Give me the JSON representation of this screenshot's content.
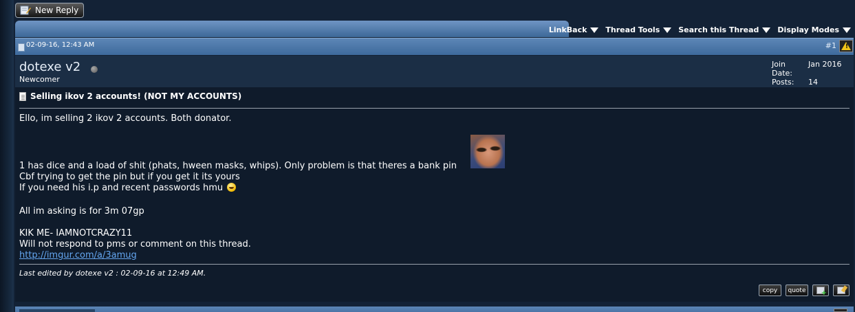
{
  "actions": {
    "new_reply_label": "New Reply"
  },
  "thread_menu": [
    {
      "label": "LinkBack",
      "icon": "caret-down-icon"
    },
    {
      "label": "Thread Tools",
      "icon": "caret-down-icon"
    },
    {
      "label": "Search this Thread",
      "icon": "caret-down-icon"
    },
    {
      "label": "Display Modes",
      "icon": "caret-down-icon"
    }
  ],
  "post": {
    "date": "02-09-16, 12:43 AM",
    "number": "#1",
    "author": {
      "username": "dotexe v2",
      "status": "offline",
      "title": "Newcomer",
      "join_date_label": "Join Date:",
      "join_date": "Jan 2016",
      "posts_label": "Posts:",
      "posts": "14"
    },
    "title": "Selling ikov 2 accounts! (NOT MY ACCOUNTS)",
    "lines": {
      "l1": "Ello, im selling 2 ikov 2 accounts. Both donator.",
      "l2": "1 has dice and a load of shit (phats, hween masks, whips). Only problem is that theres a bank pin",
      "l3": "Cbf trying to get the pin but if you get it its yours",
      "l4": "If you need his i.p and recent passwords hmu",
      "l5": "All im asking is for 3m 07gp",
      "l6": "KIK ME- IAMNOTCRAZY11",
      "l7": "Will not respond to pms or comment on this thread.",
      "link": "http://imgur.com/a/3amug"
    },
    "edit_note": "Last edited by dotexe v2 : 02-09-16 at 12:49 AM.",
    "buttons": {
      "copy": "copy",
      "quote": "quote"
    }
  },
  "colors": {
    "page_bg": "#132236",
    "header_blue": "#4f7aab",
    "message_bg": "#0f1b2b",
    "link": "#64a6f0"
  }
}
